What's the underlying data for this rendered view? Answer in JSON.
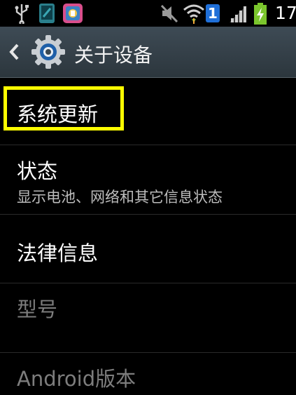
{
  "status_bar": {
    "time": "17:",
    "notification_count": "1",
    "icons": [
      "usb-icon",
      "tablet-icon",
      "app-icon",
      "mute-icon",
      "wifi-icon",
      "badge-icon",
      "signal-icon",
      "battery-charging-icon"
    ]
  },
  "action_bar": {
    "title": "关于设备",
    "icons": [
      "back-arrow-icon",
      "settings-gear-icon"
    ]
  },
  "list": {
    "items": [
      {
        "title": "系统更新",
        "highlighted": true
      },
      {
        "title": "状态",
        "subtitle": "显示电池、网络和其它信息状态"
      },
      {
        "title": "法律信息"
      },
      {
        "title": "型号"
      },
      {
        "title": "Android版本"
      }
    ]
  },
  "colors": {
    "highlight_border": "#ffff00",
    "action_bar": "#36424a",
    "background": "#000000",
    "battery": "#7bc62d",
    "badge": "#1f6fd8"
  }
}
